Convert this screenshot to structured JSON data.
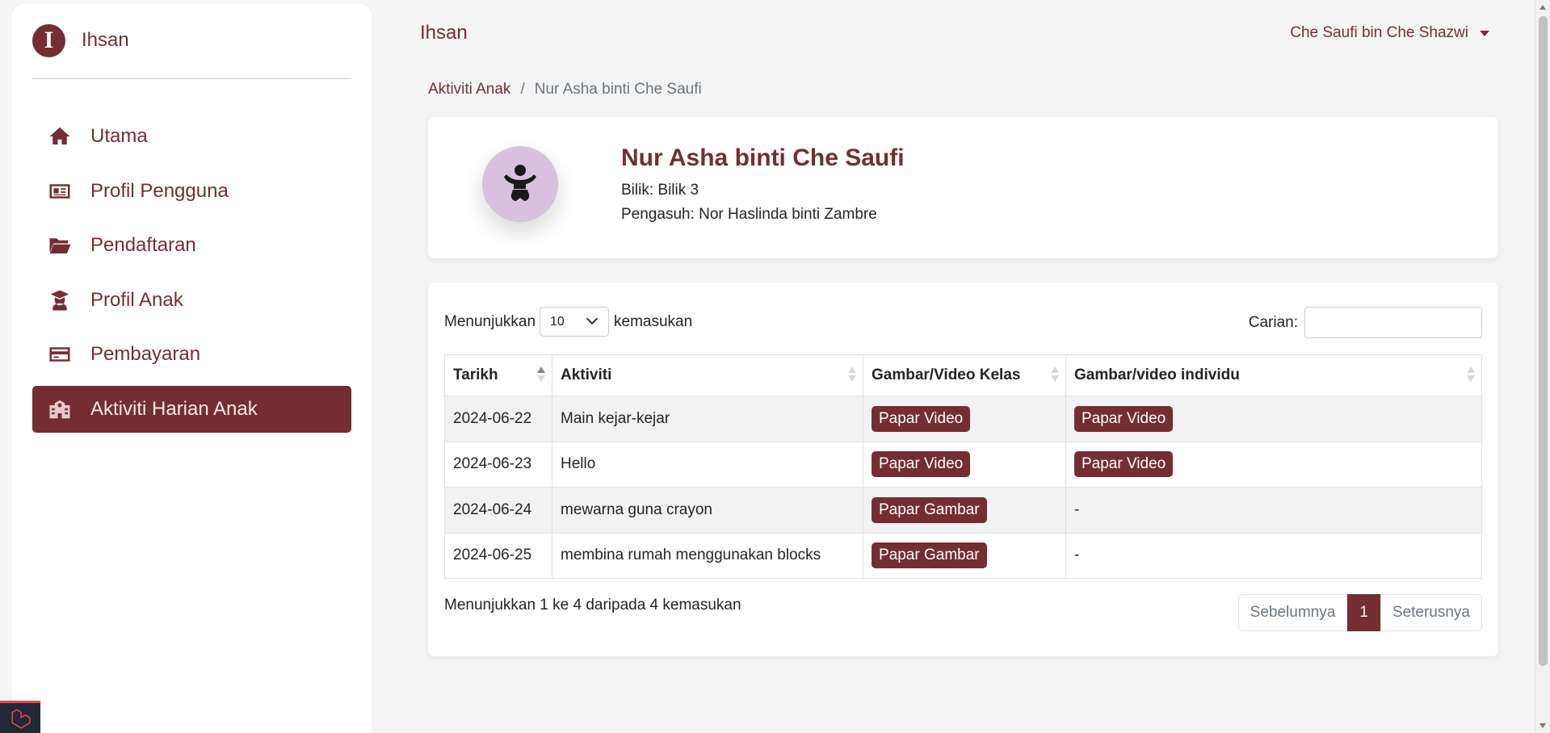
{
  "brand": {
    "initial": "I",
    "name": "Ihsan"
  },
  "sidebar": {
    "items": [
      {
        "label": "Utama",
        "icon": "home-icon"
      },
      {
        "label": "Profil Pengguna",
        "icon": "id-card-icon"
      },
      {
        "label": "Pendaftaran",
        "icon": "folder-open-icon"
      },
      {
        "label": "Profil Anak",
        "icon": "graduate-icon"
      },
      {
        "label": "Pembayaran",
        "icon": "credit-card-icon"
      },
      {
        "label": "Aktiviti Harian Anak",
        "icon": "school-icon",
        "active": true
      }
    ]
  },
  "header": {
    "title": "Ihsan",
    "user": "Che Saufi bin Che Shazwi"
  },
  "breadcrumb": {
    "parent": "Aktiviti Anak",
    "separator": "/",
    "current": "Nur Asha binti Che Saufi"
  },
  "profile": {
    "name": "Nur Asha binti Che Saufi",
    "room": "Bilik: Bilik 3",
    "caregiver": "Pengasuh: Nor Haslinda binti Zambre"
  },
  "table_controls": {
    "show_label": "Menunjukkan",
    "page_length": "10",
    "entries_label": "kemasukan",
    "search_label": "Carian:",
    "search_value": ""
  },
  "table": {
    "headers": [
      "Tarikh",
      "Aktiviti",
      "Gambar/Video Kelas",
      "Gambar/video individu"
    ],
    "rows": [
      {
        "date": "2024-06-22",
        "activity": "Main kejar-kejar",
        "class_media": "Papar Video",
        "individual_media": "Papar Video"
      },
      {
        "date": "2024-06-23",
        "activity": "Hello",
        "class_media": "Papar Video",
        "individual_media": "Papar Video"
      },
      {
        "date": "2024-06-24",
        "activity": "mewarna guna crayon",
        "class_media": "Papar Gambar",
        "individual_media": "-"
      },
      {
        "date": "2024-06-25",
        "activity": "membina rumah menggunakan blocks",
        "class_media": "Papar Gambar",
        "individual_media": "-"
      }
    ]
  },
  "footer": {
    "info": "Menunjukkan 1 ke 4 daripada 4 kemasukan",
    "prev": "Sebelumnya",
    "page": "1",
    "next": "Seterusnya"
  },
  "colors": {
    "accent": "#742e32",
    "avatar_bg": "#d8c1de",
    "page_bg": "#f4f4f4"
  }
}
